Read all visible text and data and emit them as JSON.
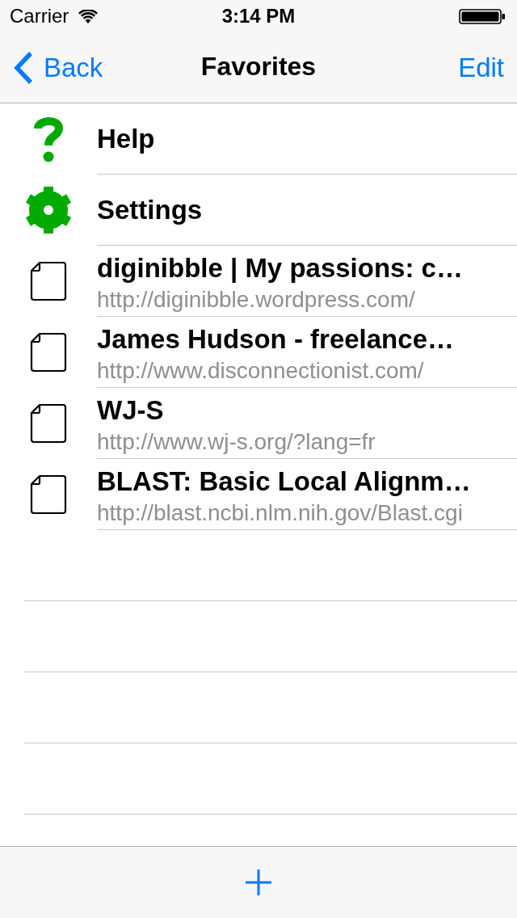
{
  "status_bar": {
    "carrier": "Carrier",
    "time": "3:14 PM"
  },
  "nav_bar": {
    "back_label": "Back",
    "title": "Favorites",
    "edit_label": "Edit"
  },
  "favorites": [
    {
      "kind": "help",
      "title": "Help"
    },
    {
      "kind": "settings",
      "title": "Settings"
    },
    {
      "kind": "page",
      "title": "diginibble | My passions: c…",
      "url": "http://diginibble.wordpress.com/"
    },
    {
      "kind": "page",
      "title": "James Hudson - freelance…",
      "url": "http://www.disconnectionist.com/"
    },
    {
      "kind": "page",
      "title": "WJ-S",
      "url": "http://www.wj-s.org/?lang=fr"
    },
    {
      "kind": "page",
      "title": "BLAST: Basic Local Alignm…",
      "url": "http://blast.ncbi.nlm.nih.gov/Blast.cgi"
    }
  ]
}
